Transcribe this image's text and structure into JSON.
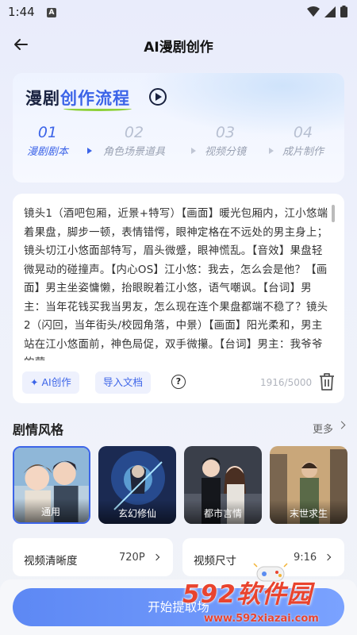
{
  "status_bar": {
    "time": "1:44",
    "notif_icon": "A"
  },
  "header": {
    "title": "AI漫剧创作"
  },
  "flow": {
    "title_prefix": "漫剧",
    "title_highlight": "创作流程",
    "steps": [
      {
        "num": "01",
        "label": "漫剧剧本",
        "active": true
      },
      {
        "num": "02",
        "label": "角色场景道具",
        "active": false
      },
      {
        "num": "03",
        "label": "视频分镜",
        "active": false
      },
      {
        "num": "04",
        "label": "成片制作",
        "active": false
      }
    ]
  },
  "script": {
    "text": "镜头1（酒吧包厢，近景+特写）【画面】暖光包厢内，江小悠端着果盘，脚步一顿，表情错愕，眼神定格在不远处的男主身上；镜头切江小悠面部特写，眉头微蹙，眼神慌乱。【音效】果盘轻微晃动的碰撞声。【内心OS】江小悠：我去，怎么会是他？【画面】男主坐姿慵懒，抬眼睨着江小悠，语气嘲讽。【台词】男主：当年花钱买我当男友，怎么现在连个果盘都端不稳了？镜头2（闪回，当年街头/校园角落，中景）【画面】阳光柔和，男主站在江小悠面前，神色局促，双手微攥。【台词】男主：我爷爷的营",
    "ai_button": "AI创作",
    "import_button": "导入文档",
    "char_count": "1916/5000"
  },
  "styles_section": {
    "title": "剧情风格",
    "more": "更多",
    "items": [
      {
        "label": "通用",
        "selected": true
      },
      {
        "label": "玄幻修仙",
        "selected": false
      },
      {
        "label": "都市言情",
        "selected": false
      },
      {
        "label": "末世求生",
        "selected": false
      }
    ]
  },
  "settings": {
    "resolution_label": "视频清晰度",
    "resolution_value": "720P",
    "size_label": "视频尺寸",
    "size_value": "9:16"
  },
  "primary_action": {
    "label": "开始提取场"
  },
  "watermark": {
    "logo": "592软件园",
    "url": "www.592xiazai.com"
  },
  "colors": {
    "accent": "#3c64e8",
    "button": "#6c94f8",
    "watermark": "#e9442e"
  }
}
